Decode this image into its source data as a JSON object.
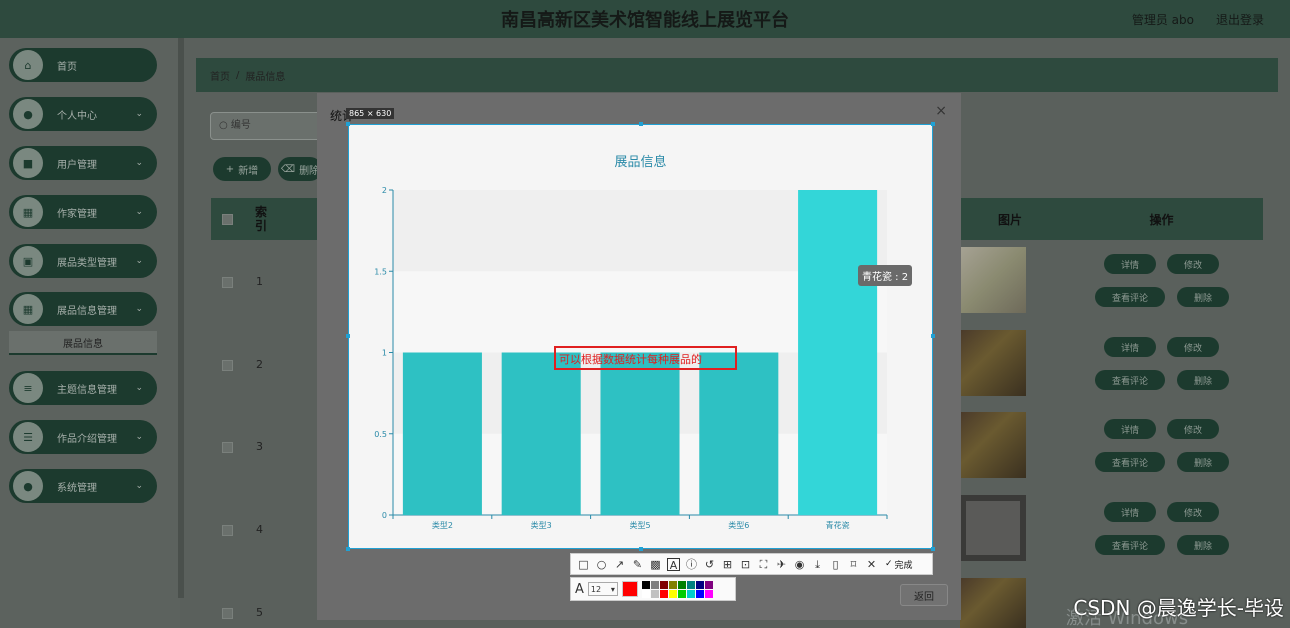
{
  "header": {
    "title": "南昌高新区美术馆智能线上展览平台",
    "user": "管理员 abo",
    "logout": "退出登录"
  },
  "sidebar": {
    "items": [
      {
        "label": "首页",
        "icon": "home-icon",
        "glyph": "⌂",
        "has_children": false
      },
      {
        "label": "个人中心",
        "icon": "user-icon",
        "glyph": "●",
        "has_children": true
      },
      {
        "label": "用户管理",
        "icon": "user-group-icon",
        "glyph": "■",
        "has_children": true
      },
      {
        "label": "作家管理",
        "icon": "grid-icon",
        "glyph": "▦",
        "has_children": true
      },
      {
        "label": "展品类型管理",
        "icon": "bag-icon",
        "glyph": "▣",
        "has_children": true
      },
      {
        "label": "展品信息管理",
        "icon": "grid-icon",
        "glyph": "▦",
        "has_children": true
      },
      {
        "label": "主题信息管理",
        "icon": "list-icon",
        "glyph": "≡",
        "has_children": true
      },
      {
        "label": "作品介绍管理",
        "icon": "menu-icon",
        "glyph": "☰",
        "has_children": true
      },
      {
        "label": "系统管理",
        "icon": "user-icon",
        "glyph": "●",
        "has_children": true
      }
    ],
    "sub_item": "展品信息",
    "chevron": "⌄"
  },
  "breadcrumb": {
    "home": "首页",
    "sep": "/",
    "current": "展品信息"
  },
  "search": {
    "placeholder": "编号"
  },
  "toolbar": {
    "add_label": "新增",
    "delete_label": "删除"
  },
  "table": {
    "col_index": "索引",
    "col_image": "图片",
    "col_action": "操作",
    "rows": [
      "1",
      "2",
      "3",
      "4",
      "5"
    ],
    "actions": {
      "detail": "详情",
      "edit": "修改",
      "review": "查看评论",
      "delete": "删除"
    }
  },
  "modal": {
    "title": "统计",
    "close": "×",
    "back": "返回"
  },
  "screenshot_tool": {
    "size_badge": "865 × 630",
    "annotation_text": "可以根据数据统计每种展品的",
    "font_size": "12",
    "done_label": "完成",
    "current_color": "#ff0000",
    "palette": [
      "#000000",
      "#808080",
      "#800000",
      "#808000",
      "#008000",
      "#008080",
      "#000080",
      "#800080",
      "#ffffff",
      "#c0c0c0",
      "#ff0000",
      "#ffff00",
      "#00cc00",
      "#00cccc",
      "#0000ff",
      "#ff00ff"
    ]
  },
  "tooltip": {
    "text": "青花瓷 : 2"
  },
  "watermark": {
    "csdn": "CSDN @晨逸学长-毕设",
    "windows": "激活 Windows"
  },
  "chart_data": {
    "type": "bar",
    "title": "展品信息",
    "categories": [
      "类型2",
      "类型3",
      "类型5",
      "类型6",
      "青花瓷"
    ],
    "values": [
      1,
      1,
      1,
      1,
      2
    ],
    "ylim": [
      0,
      2
    ],
    "yticks": [
      "0",
      "0.5",
      "1",
      "1.5",
      "2"
    ],
    "bar_color": "#2ec1c3",
    "highlight_color": "#33d6d8",
    "highlight_index": 4
  }
}
